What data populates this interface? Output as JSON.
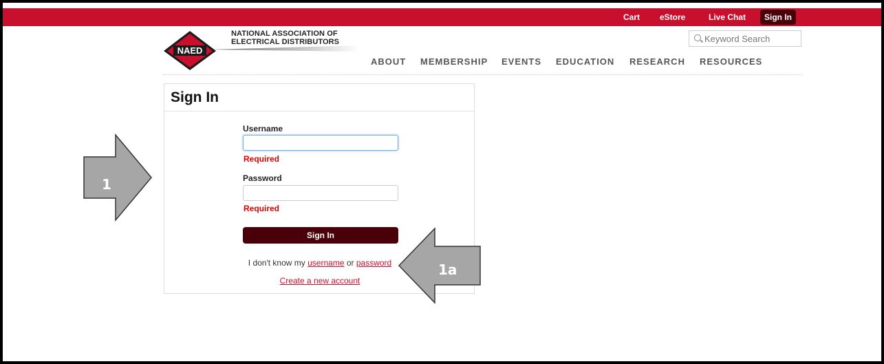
{
  "topbar": {
    "cart": "Cart",
    "estore": "eStore",
    "live_chat": "Live Chat",
    "sign_in": "Sign In",
    "color": "#c8102e"
  },
  "search": {
    "placeholder": "Keyword Search",
    "icon": "search-icon"
  },
  "logo": {
    "badge": "NAED",
    "org_name_line1": "NATIONAL ASSOCIATION OF",
    "org_name_line2": "ELECTRICAL DISTRIBUTORS"
  },
  "nav": {
    "items": [
      "ABOUT",
      "MEMBERSHIP",
      "EVENTS",
      "EDUCATION",
      "RESEARCH",
      "RESOURCES"
    ]
  },
  "signin_panel": {
    "title": "Sign In",
    "username_label": "Username",
    "username_value": "",
    "username_error": "Required",
    "password_label": "Password",
    "password_value": "",
    "password_error": "Required",
    "submit_label": "Sign In",
    "forgot_prefix": "I don't know my",
    "forgot_username": "username",
    "forgot_or": "or",
    "forgot_password": "password",
    "create_account": "Create a new account",
    "button_color": "#4a0008"
  },
  "annotations": {
    "arrow1_label": "1",
    "arrow2_label": "1a",
    "arrow_color": "#a6a6a6"
  }
}
